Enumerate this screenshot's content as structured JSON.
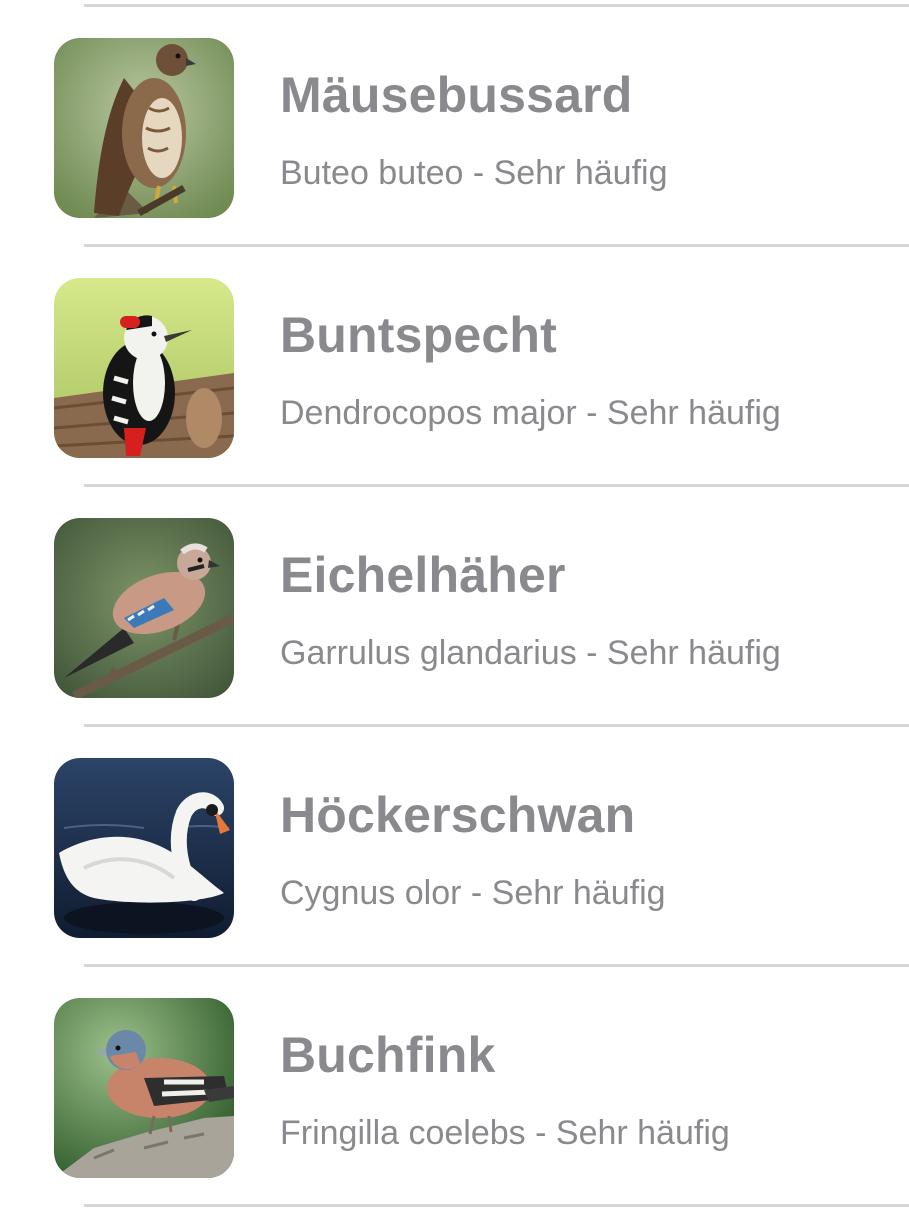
{
  "birds": [
    {
      "name": "Mäusebussard",
      "details": "Buteo buteo - Sehr häufig",
      "icon": "buzzard-photo"
    },
    {
      "name": "Buntspecht",
      "details": "Dendrocopos major - Sehr häufig",
      "icon": "woodpecker-photo"
    },
    {
      "name": "Eichelhäher",
      "details": "Garrulus glandarius - Sehr häufig",
      "icon": "jay-photo"
    },
    {
      "name": "Höckerschwan",
      "details": "Cygnus olor - Sehr häufig",
      "icon": "swan-photo"
    },
    {
      "name": "Buchfink",
      "details": "Fringilla coelebs - Sehr häufig",
      "icon": "chaffinch-photo"
    }
  ],
  "colors": {
    "text": "#8a8a8e",
    "separator": "#d6d6d8",
    "background": "#ffffff"
  }
}
